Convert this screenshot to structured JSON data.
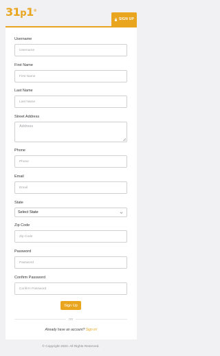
{
  "brand": {
    "logo_main": "31",
    "logo_p": "p",
    "logo_one": "1",
    "logo_reg": "®"
  },
  "header": {
    "signup_tab_label": "SIGN UP"
  },
  "form": {
    "username_label": "Username",
    "username_placeholder": "Username",
    "firstname_label": "First Name",
    "firstname_placeholder": "First Name",
    "lastname_label": "Last Name",
    "lastname_placeholder": "Last Name",
    "address_label": "Street Address",
    "address_placeholder": "Address",
    "phone_label": "Phone",
    "phone_placeholder": "Phone",
    "email_label": "Email",
    "email_placeholder": "Email",
    "state_label": "State",
    "state_selected": "Select State",
    "zip_label": "Zip Code",
    "zip_placeholder": "Zip Code",
    "password_label": "Password",
    "password_placeholder": "Password",
    "confirm_label": "Confirm Password",
    "confirm_placeholder": "Confirm Password",
    "submit_label": "Sign Up"
  },
  "footer_links": {
    "or": "OR",
    "have_account": "Already have an account?",
    "signin": "Sign in!"
  },
  "footer": {
    "copyright": "© Copyright 2020. All Rights Reserved."
  },
  "colors": {
    "accent": "#e9a51e",
    "background": "#f1f1f3",
    "card": "#ffffff",
    "border": "#cfcfd4"
  },
  "icons": {
    "signup_tab": "lock-icon",
    "state_select": "chevron-down-icon",
    "textarea_resize": "resize-handle-icon"
  }
}
